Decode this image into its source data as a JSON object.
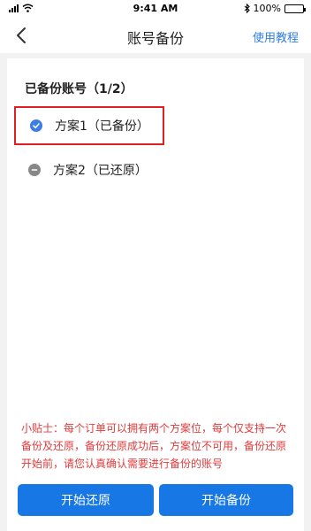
{
  "status_bar": {
    "time": "9:41 AM",
    "battery": "100%"
  },
  "nav": {
    "title": "账号备份",
    "help_link": "使用教程"
  },
  "section_title": "已备份账号（1/2）",
  "options": [
    {
      "label": "方案1（已备份）",
      "state": "backed-up",
      "selected": true
    },
    {
      "label": "方案2（已还原）",
      "state": "restored",
      "selected": false
    }
  ],
  "tip": "小贴士：每个订单可以拥有两个方案位，每个仅支持一次备份及还原，备份还原成功后，方案位不可用，备份还原开始前，请您认真确认需要进行备份的账号",
  "buttons": {
    "restore": "开始还原",
    "backup": "开始备份"
  },
  "colors": {
    "accent": "#1677e5",
    "tip": "#e03b3b",
    "highlight": "#e02020"
  }
}
